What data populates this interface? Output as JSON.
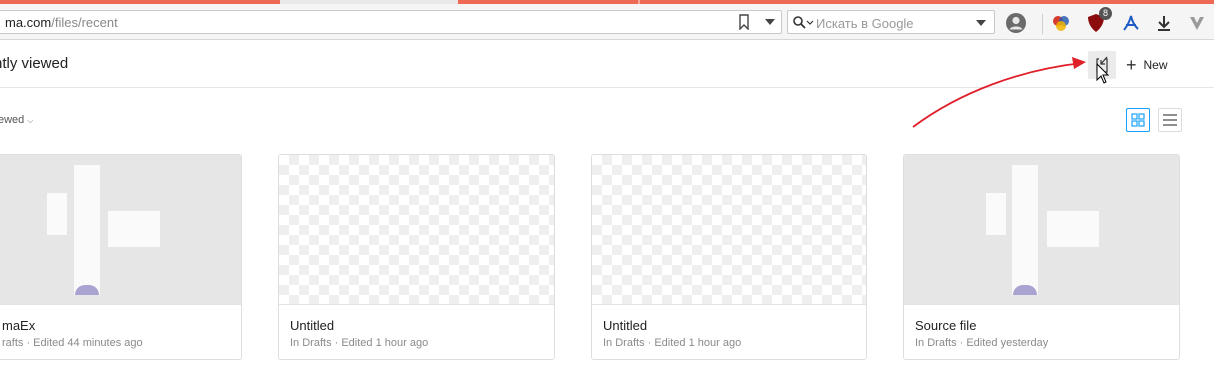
{
  "browser": {
    "url_host": "ma.com",
    "url_path": "/files/recent",
    "search_placeholder": "Искать в Google",
    "extension_badge": "8"
  },
  "header": {
    "title": "ntly viewed",
    "new_label": "New"
  },
  "filter": {
    "sort_label": "ewed"
  },
  "files": [
    {
      "title": "maEx",
      "meta": "rafts · Edited 44 minutes ago"
    },
    {
      "title": "Untitled",
      "meta": "In Drafts · Edited 1 hour ago"
    },
    {
      "title": "Untitled",
      "meta": "In Drafts · Edited 1 hour ago"
    },
    {
      "title": "Source file",
      "meta": "In Drafts · Edited yesterday"
    }
  ],
  "colors": {
    "accent": "#18a0fb",
    "annotation_arrow": "#e0202a",
    "tab_bar": "#ee6a55"
  }
}
